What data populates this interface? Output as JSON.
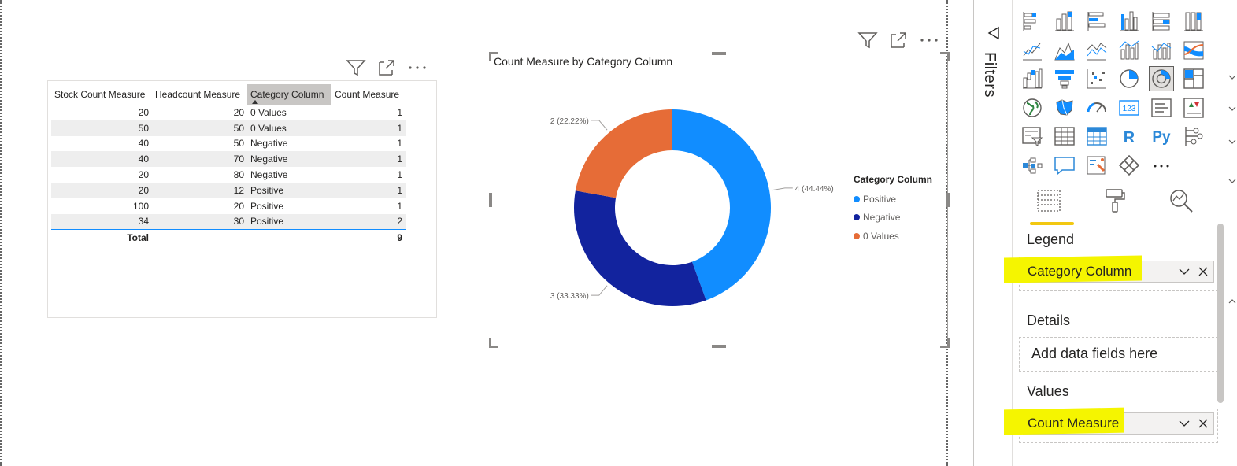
{
  "table": {
    "columns": [
      "Stock Count Measure",
      "Headcount Measure",
      "Category Column",
      "Count Measure"
    ],
    "sorted_column": "Category Column",
    "rows": [
      [
        "20",
        "20",
        "0 Values",
        "1"
      ],
      [
        "50",
        "50",
        "0 Values",
        "1"
      ],
      [
        "40",
        "50",
        "Negative",
        "1"
      ],
      [
        "40",
        "70",
        "Negative",
        "1"
      ],
      [
        "20",
        "80",
        "Negative",
        "1"
      ],
      [
        "20",
        "12",
        "Positive",
        "1"
      ],
      [
        "100",
        "20",
        "Positive",
        "1"
      ],
      [
        "34",
        "30",
        "Positive",
        "2"
      ]
    ],
    "total": {
      "label": "Total",
      "value": "9"
    }
  },
  "donut": {
    "title": "Count Measure by Category Column",
    "legend_title": "Category Column",
    "legend": [
      "Positive",
      "Negative",
      "0 Values"
    ]
  },
  "chart_data": {
    "type": "pie",
    "title": "Count Measure by Category Column",
    "legend_title": "Category Column",
    "categories": [
      "Positive",
      "Negative",
      "0 Values"
    ],
    "values": [
      4,
      3,
      2
    ],
    "labels": [
      "4 (44.44%)",
      "3 (33.33%)",
      "2 (22.22%)"
    ],
    "colors": [
      "#118dff",
      "#12239e",
      "#e66c37"
    ],
    "hole": true,
    "legend_position": "right"
  },
  "filters": {
    "label": "Filters"
  },
  "viz_pane": {
    "tabs": [
      "fields-tab",
      "format-tab",
      "analytics-tab"
    ],
    "legend_label": "Legend",
    "legend_field": "Category Column",
    "details_label": "Details",
    "details_placeholder": "Add data fields here",
    "values_label": "Values",
    "values_field": "Count Measure",
    "python_label": "Py",
    "r_label": "R",
    "card_label": "123",
    "more_label": "...",
    "highlight_color": "#f5f500",
    "accent_color": "#f2c811"
  }
}
